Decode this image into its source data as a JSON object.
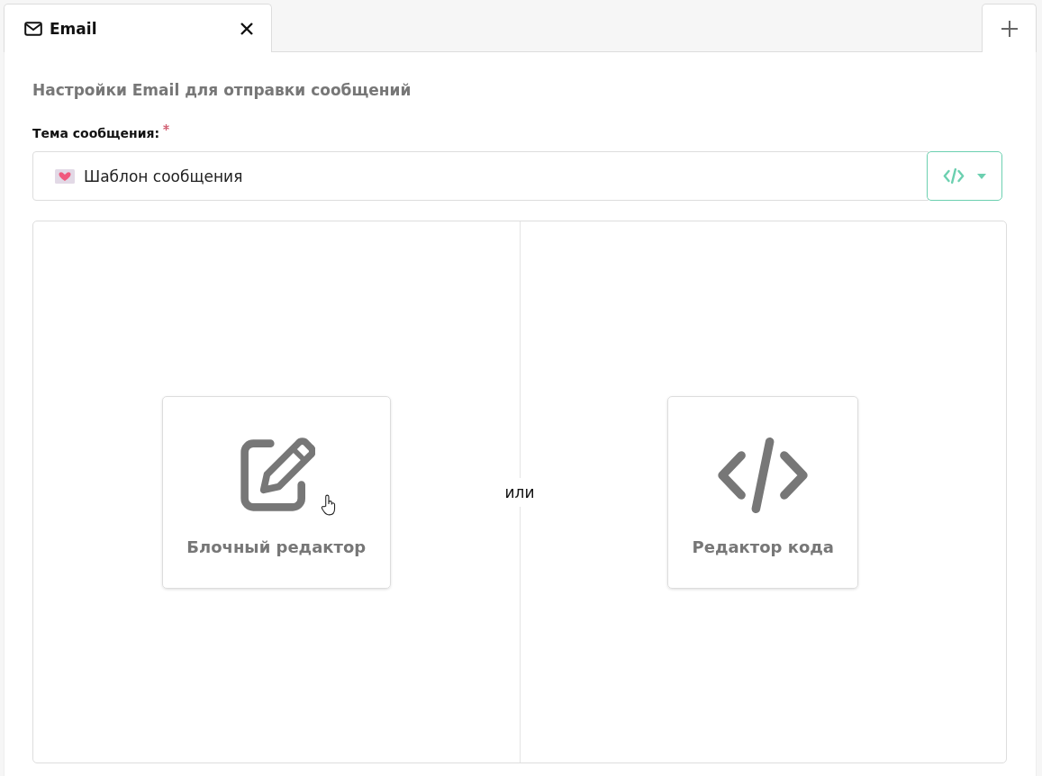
{
  "tabs": [
    {
      "label": "Email",
      "selected": true
    }
  ],
  "panel": {
    "heading": "Настройки Email для отправки сообщений",
    "subject": {
      "label": "Тема сообщения:",
      "required": true,
      "value": "Шаблон сообщения"
    },
    "editors": [
      {
        "kind": "block",
        "label": "Блочный редактор"
      },
      {
        "kind": "code",
        "label": "Редактор кода"
      }
    ],
    "separator": "или"
  }
}
